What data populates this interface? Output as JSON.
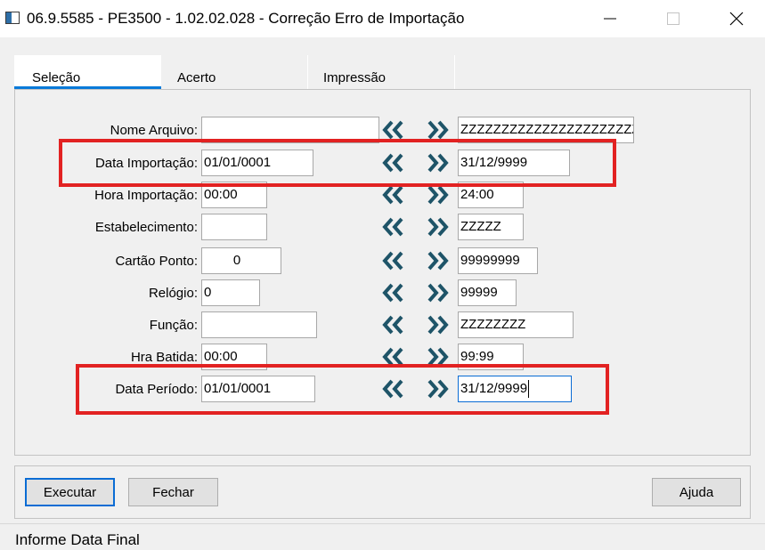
{
  "window": {
    "title": "06.9.5585 - PE3500 - 1.02.02.028 - Correção Erro de Importação"
  },
  "tabs": [
    {
      "label": "Seleção",
      "active": true
    },
    {
      "label": "Acerto",
      "active": false
    },
    {
      "label": "Impressão",
      "active": false
    }
  ],
  "fields": [
    {
      "label": "Nome Arquivo:",
      "from": "",
      "to": "ZZZZZZZZZZZZZZZZZZZZZZZZZZ"
    },
    {
      "label": "Data Importação:",
      "from": "01/01/0001",
      "to": "31/12/9999"
    },
    {
      "label": "Hora Importação:",
      "from": "00:00",
      "to": "24:00"
    },
    {
      "label": "Estabelecimento:",
      "from": "",
      "to": "ZZZZZ"
    },
    {
      "label": "Cartão Ponto:",
      "from": "0",
      "to": "99999999"
    },
    {
      "label": "Relógio:",
      "from": "0",
      "to": "99999"
    },
    {
      "label": "Função:",
      "from": "",
      "to": "ZZZZZZZZ"
    },
    {
      "label": "Hra Batida:",
      "from": "00:00",
      "to": "99:99"
    },
    {
      "label": "Data Período:",
      "from": "01/01/0001",
      "to": "31/12/9999"
    }
  ],
  "buttons": {
    "execute": "Executar",
    "close": "Fechar",
    "help": "Ajuda"
  },
  "status": {
    "text": "Informe Data Final"
  },
  "colors": {
    "highlight": "#e22222",
    "arrow": "#1e5468",
    "accent": "#0a7ad9"
  }
}
